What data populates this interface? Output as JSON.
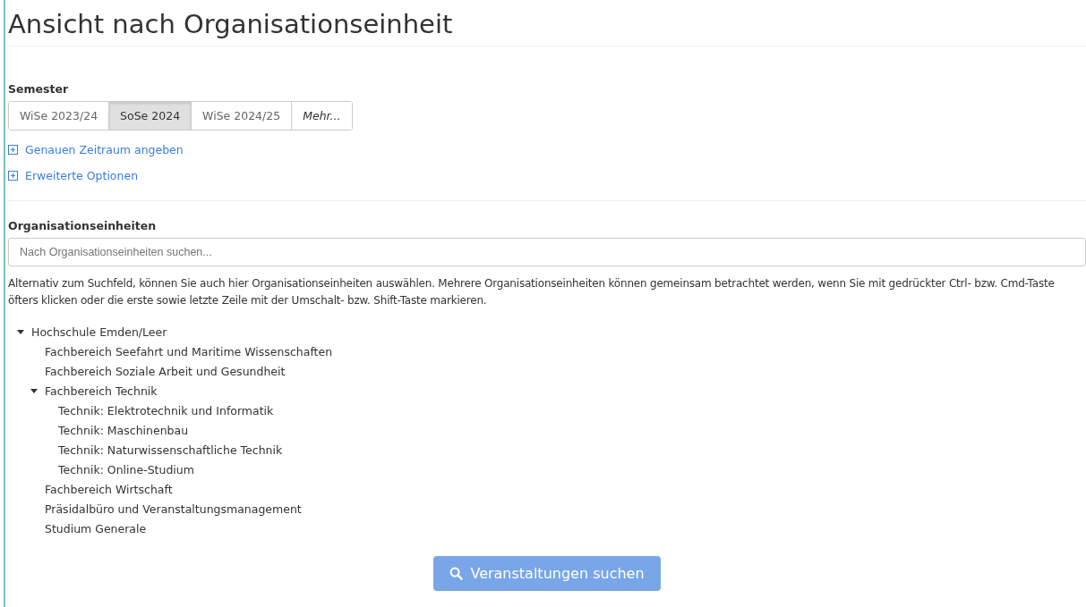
{
  "page_title": "Ansicht nach Organisationseinheit",
  "semester": {
    "label": "Semester",
    "options": [
      {
        "label": "WiSe 2023/24",
        "selected": false,
        "kind": "term"
      },
      {
        "label": "SoSe 2024",
        "selected": true,
        "kind": "term"
      },
      {
        "label": "WiSe 2024/25",
        "selected": false,
        "kind": "term"
      },
      {
        "label": "Mehr...",
        "selected": false,
        "kind": "more"
      }
    ]
  },
  "toggles": [
    {
      "label": "Genauen Zeitraum angeben",
      "expanded": false
    },
    {
      "label": "Erweiterte Optionen",
      "expanded": false
    }
  ],
  "org_units": {
    "label": "Organisationseinheiten",
    "search": {
      "placeholder": "Nach Organisationseinheiten suchen..."
    },
    "help_text": "Alternativ zum Suchfeld, können Sie auch hier Organisationseinheiten auswählen. Mehrere Organisationseinheiten können gemeinsam betrachtet werden, wenn Sie mit gedrückter Ctrl- bzw. Cmd-Taste öfters klicken oder die erste sowie letzte Zeile mit der Umschalt- bzw. Shift-Taste markieren.",
    "tree": [
      {
        "label": "Hochschule Emden/Leer",
        "expanded": true,
        "children": [
          {
            "label": "Fachbereich Seefahrt und Maritime Wissenschaften"
          },
          {
            "label": "Fachbereich Soziale Arbeit und Gesundheit"
          },
          {
            "label": "Fachbereich Technik",
            "expanded": true,
            "children": [
              {
                "label": "Technik: Elektrotechnik und Informatik"
              },
              {
                "label": "Technik: Maschinenbau"
              },
              {
                "label": "Technik: Naturwissenschaftliche Technik"
              },
              {
                "label": "Technik: Online-Studium"
              }
            ]
          },
          {
            "label": "Fachbereich Wirtschaft"
          },
          {
            "label": "Präsidalbüro und Veranstaltungsmanagement"
          },
          {
            "label": "Studium Generale"
          }
        ]
      }
    ]
  },
  "search_button": {
    "label": "Veranstaltungen suchen"
  }
}
